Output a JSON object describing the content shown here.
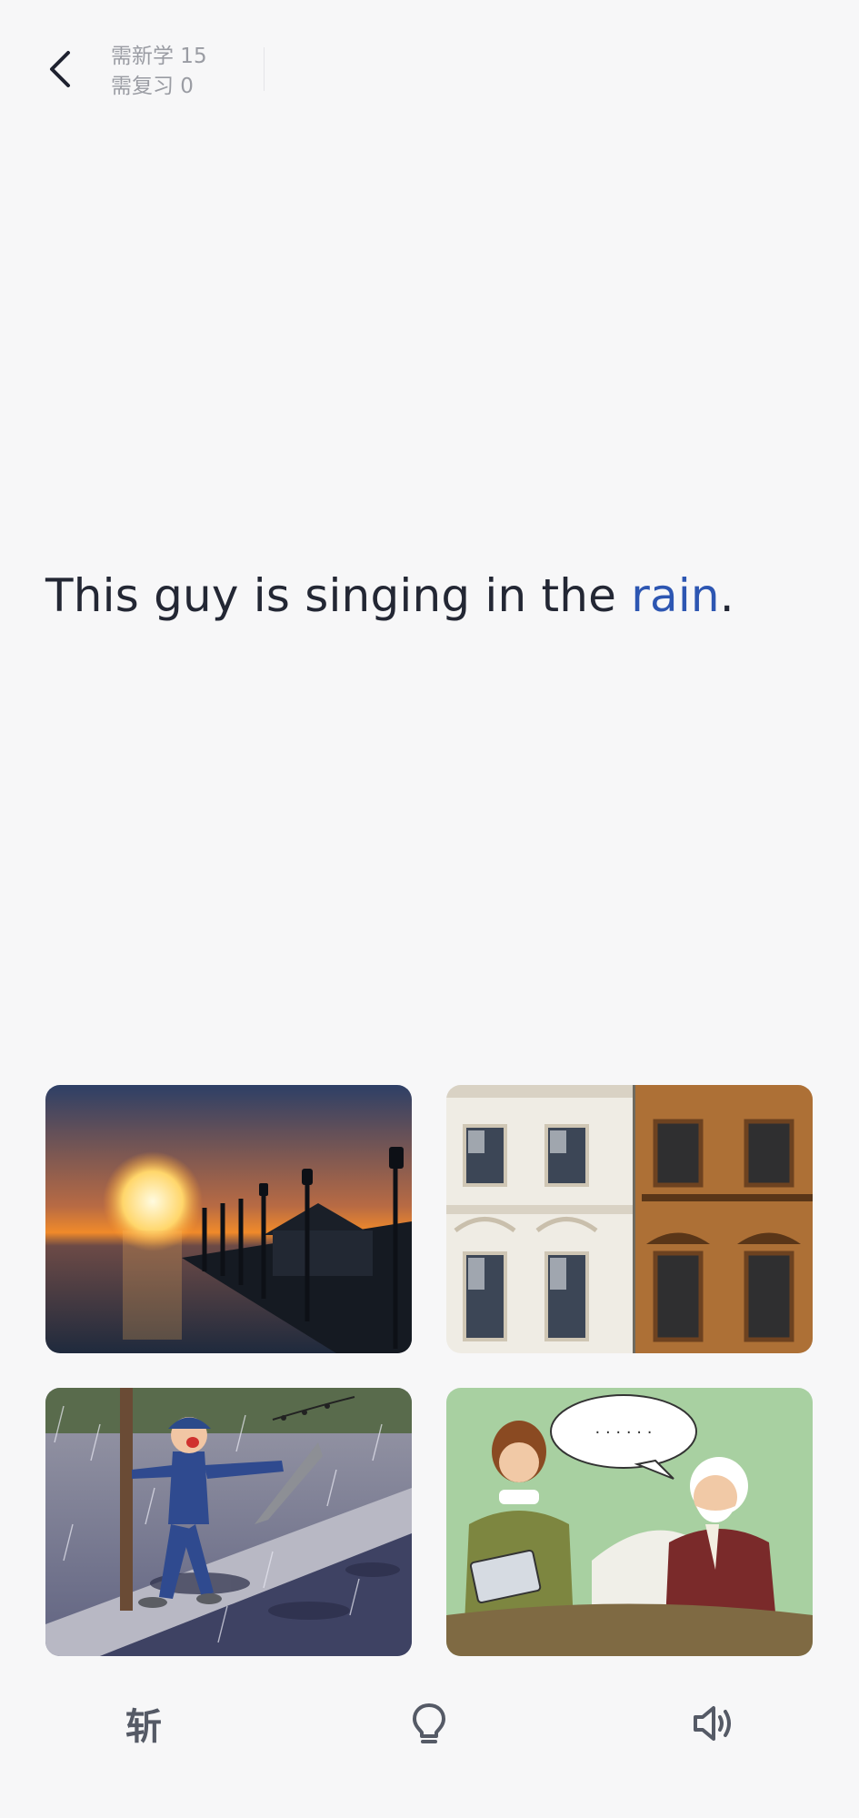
{
  "header": {
    "new_learn": "需新学 15",
    "review": "需复习 0"
  },
  "sentence": {
    "before": "This guy is singing in the ",
    "keyword": "rain",
    "after": "."
  },
  "options": [
    {
      "name": "sunset-pier-image"
    },
    {
      "name": "building-facades-image"
    },
    {
      "name": "man-singing-rain-image"
    },
    {
      "name": "elderly-conversation-image"
    }
  ],
  "toolbar": {
    "slash_label": "斩",
    "hint_icon": "lightbulb-icon",
    "audio_icon": "speaker-icon"
  },
  "colors": {
    "highlight": "#2d56b2",
    "text": "#232734",
    "muted": "#9a9ca3"
  }
}
